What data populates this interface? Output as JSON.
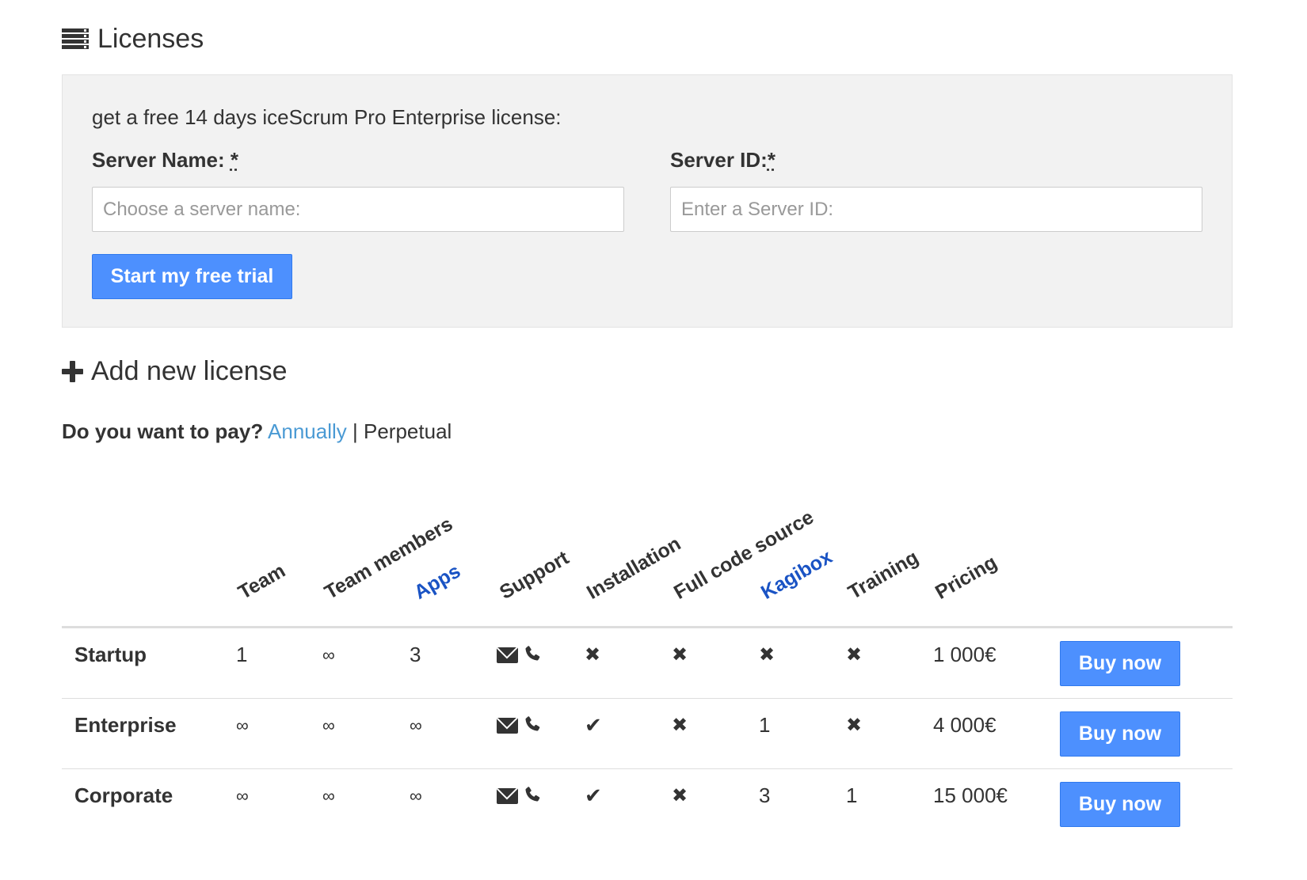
{
  "licenses": {
    "title": "Licenses"
  },
  "trial": {
    "intro": "get a free 14 days iceScrum Pro Enterprise license:",
    "server_name_label": "Server Name: ",
    "server_name_req": "*",
    "server_name_placeholder": "Choose a server name:",
    "server_id_label": "Server ID:",
    "server_id_req": "*",
    "server_id_placeholder": "Enter a Server ID:",
    "start_button": "Start my free trial"
  },
  "add_license": {
    "title": "Add new license",
    "pay_question": "Do you want to pay?",
    "annually": "Annually",
    "separator": "|",
    "perpetual": "Perpetual"
  },
  "table": {
    "columns": [
      "Team",
      "Team members",
      "Apps",
      "Support",
      "Installation",
      "Full code source",
      "Kagibox",
      "Training",
      "Pricing"
    ],
    "rows": [
      {
        "plan": "Startup",
        "team": "1",
        "members": "∞",
        "apps": "3",
        "installation": "✖",
        "source": "✖",
        "kagibox": "✖",
        "training": "✖",
        "price": "1 000€",
        "buy": "Buy now"
      },
      {
        "plan": "Enterprise",
        "team": "∞",
        "members": "∞",
        "apps": "∞",
        "installation": "✔",
        "source": "✖",
        "kagibox": "1",
        "training": "✖",
        "price": "4 000€",
        "buy": "Buy now"
      },
      {
        "plan": "Corporate",
        "team": "∞",
        "members": "∞",
        "apps": "∞",
        "installation": "✔",
        "source": "✖",
        "kagibox": "3",
        "training": "1",
        "price": "15 000€",
        "buy": "Buy now"
      }
    ]
  },
  "icons": {
    "licenses": "server-icon",
    "add": "plus-icon",
    "support_email": "envelope-icon",
    "support_phone": "phone-icon"
  },
  "colors": {
    "button": "#4d90fe",
    "link": "#4a9ad4",
    "column_link": "#1a53c4",
    "panel": "#f2f2f2"
  }
}
